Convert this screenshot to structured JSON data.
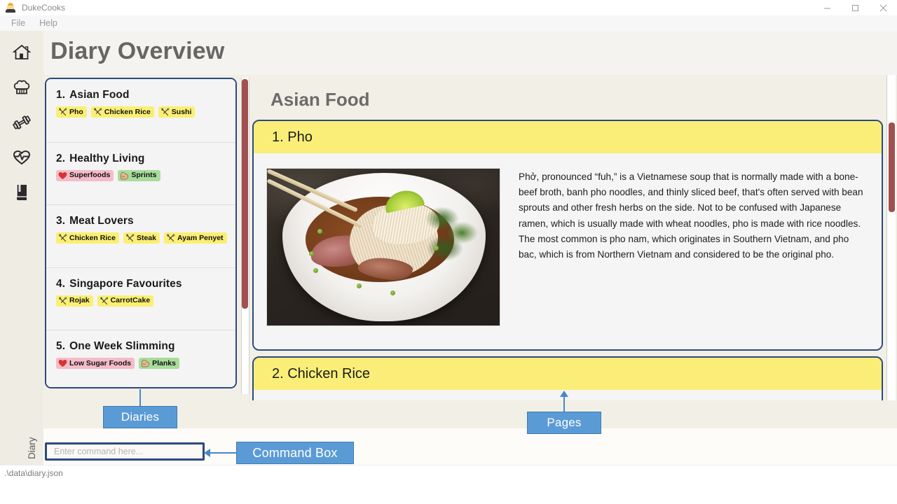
{
  "window": {
    "title": "DukeCooks",
    "app_icon": "chef-avatar-icon",
    "controls": {
      "minimize": "minimize-icon",
      "maximize": "maximize-icon",
      "close": "close-icon"
    }
  },
  "menubar": {
    "items": [
      {
        "label": "File"
      },
      {
        "label": "Help"
      }
    ]
  },
  "rail": {
    "items": [
      {
        "icon": "home-icon",
        "name": "home"
      },
      {
        "icon": "chef-hat-icon",
        "name": "recipes"
      },
      {
        "icon": "dumbbell-icon",
        "name": "workout"
      },
      {
        "icon": "heartbeat-icon",
        "name": "health"
      },
      {
        "icon": "diary-book-icon",
        "name": "diary"
      }
    ],
    "vertical_label": "Diary"
  },
  "header": {
    "title": "Diary Overview"
  },
  "diaries": {
    "items": [
      {
        "number": "1.",
        "title": "Asian Food",
        "tags": [
          {
            "label": "Pho",
            "type": "food",
            "icon": "fork-spoon-icon"
          },
          {
            "label": "Chicken Rice",
            "type": "food",
            "icon": "fork-spoon-icon"
          },
          {
            "label": "Sushi",
            "type": "food",
            "icon": "fork-spoon-icon"
          }
        ]
      },
      {
        "number": "2.",
        "title": "Healthy Living",
        "tags": [
          {
            "label": "Superfoods",
            "type": "health",
            "icon": "heart-icon"
          },
          {
            "label": "Sprints",
            "type": "gym",
            "icon": "bicep-icon"
          }
        ]
      },
      {
        "number": "3.",
        "title": "Meat Lovers",
        "tags": [
          {
            "label": "Chicken Rice",
            "type": "food",
            "icon": "fork-spoon-icon"
          },
          {
            "label": "Steak",
            "type": "food",
            "icon": "fork-spoon-icon"
          },
          {
            "label": "Ayam Penyet",
            "type": "food",
            "icon": "fork-spoon-icon"
          }
        ]
      },
      {
        "number": "4.",
        "title": "Singapore Favourites",
        "tags": [
          {
            "label": "Rojak",
            "type": "food",
            "icon": "fork-spoon-icon"
          },
          {
            "label": "CarrotCake",
            "type": "food",
            "icon": "fork-spoon-icon"
          }
        ]
      },
      {
        "number": "5.",
        "title": "One Week Slimming",
        "tags": [
          {
            "label": "Low Sugar Foods",
            "type": "health",
            "icon": "heart-icon"
          },
          {
            "label": "Planks",
            "type": "gym",
            "icon": "bicep-icon"
          }
        ]
      }
    ]
  },
  "content": {
    "title": "Asian Food",
    "pages": [
      {
        "heading": "1. Pho",
        "image": "pho-bowl-photo",
        "description": "Phở, pronounced “fuh,” is a Vietnamese soup that is normally made with a bone-beef broth, banh pho noodles, and thinly sliced beef, that's often served with bean sprouts and other fresh herbs on the side. Not to be confused with Japanese ramen, which is usually made with wheat noodles, pho is made with rice noodles. The most common is pho nam, which originates in Southern Vietnam, and pho bac, which is from Northern Vietnam and considered to be the original pho."
      },
      {
        "heading": "2. Chicken Rice"
      }
    ]
  },
  "command_box": {
    "placeholder": "Enter command here..."
  },
  "statusbar": {
    "path": ".\\data\\diary.json"
  },
  "annotations": [
    {
      "label": "Diaries",
      "target": "diary-panel"
    },
    {
      "label": "Pages",
      "target": "page-cards"
    },
    {
      "label": "Command Box",
      "target": "command-box"
    }
  ],
  "colors": {
    "accent_border": "#2c4a7c",
    "page_heading_bg": "#faee78",
    "tag_food": "#faef72",
    "tag_health": "#f4bcc8",
    "tag_gym": "#a8dc9b",
    "callout_bg": "#5b9bd5",
    "scrollbar_thumb": "#a05050",
    "app_bg": "#f2efe6"
  }
}
